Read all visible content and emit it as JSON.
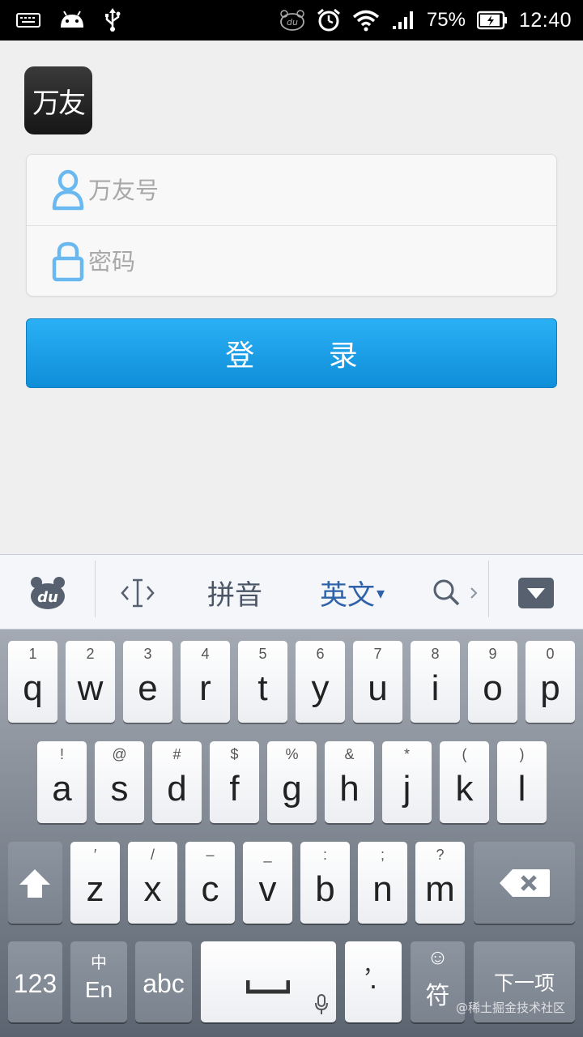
{
  "status_bar": {
    "battery_percent": "75%",
    "time": "12:40"
  },
  "app": {
    "logo_text": "万友",
    "username_placeholder": "万友号",
    "password_placeholder": "密码",
    "login_label": "登 录"
  },
  "ime_toolbar": {
    "logo": "du",
    "pinyin_label": "拼音",
    "english_label": "英文",
    "english_caret": "▾"
  },
  "keyboard": {
    "row1": [
      {
        "main": "q",
        "sub": "1"
      },
      {
        "main": "w",
        "sub": "2"
      },
      {
        "main": "e",
        "sub": "3"
      },
      {
        "main": "r",
        "sub": "4"
      },
      {
        "main": "t",
        "sub": "5"
      },
      {
        "main": "y",
        "sub": "6"
      },
      {
        "main": "u",
        "sub": "7"
      },
      {
        "main": "i",
        "sub": "8"
      },
      {
        "main": "o",
        "sub": "9"
      },
      {
        "main": "p",
        "sub": "0"
      }
    ],
    "row2": [
      {
        "main": "a",
        "sub": "!"
      },
      {
        "main": "s",
        "sub": "@"
      },
      {
        "main": "d",
        "sub": "#"
      },
      {
        "main": "f",
        "sub": "$"
      },
      {
        "main": "g",
        "sub": "%"
      },
      {
        "main": "h",
        "sub": "&"
      },
      {
        "main": "j",
        "sub": "*"
      },
      {
        "main": "k",
        "sub": "("
      },
      {
        "main": "l",
        "sub": ")"
      }
    ],
    "row3": [
      {
        "main": "z",
        "sub": "′"
      },
      {
        "main": "x",
        "sub": "/"
      },
      {
        "main": "c",
        "sub": "–"
      },
      {
        "main": "v",
        "sub": "_"
      },
      {
        "main": "b",
        "sub": ":"
      },
      {
        "main": "n",
        "sub": ";"
      },
      {
        "main": "m",
        "sub": "?"
      }
    ],
    "num_label": "123",
    "lang_top": "中",
    "lang_bottom": "En",
    "abc_label": "abc",
    "comma_label": "，",
    "period_label": "·",
    "emoji_label": "☺",
    "symbol_label": "符",
    "next_label": "下一项",
    "watermark": "@稀土掘金技术社区"
  },
  "colors": {
    "accent_blue": "#1a9fe8",
    "icon_blue": "#6ab8f0",
    "status_bar": "#000000"
  }
}
